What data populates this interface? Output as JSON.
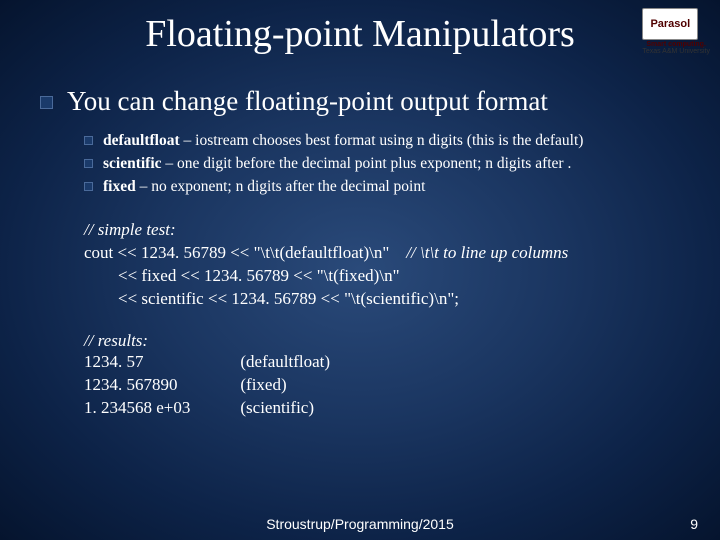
{
  "logo": {
    "name": "Parasol",
    "line1": "Smart computing.",
    "line2": "Texas A&M University"
  },
  "title": "Floating-point Manipulators",
  "main_bullet": "You can change floating-point output format",
  "sub_bullets": [
    {
      "bold": "defaultfloat",
      "rest": " – iostream chooses best format using n digits (this is the default)"
    },
    {
      "bold": "scientific",
      "rest": " – one digit before the decimal point plus exponent; n digits after ."
    },
    {
      "bold": "fixed",
      "rest": " – no exponent; n digits after the decimal point"
    }
  ],
  "code": {
    "comment1": "// simple test:",
    "l1a": "cout << 1234. 56789 << \"\\t\\t(defaultfloat)\\n\"",
    "l1c": "//  \\t\\t  to line up columns",
    "l2": "        << fixed << 1234. 56789 << \"\\t(fixed)\\n\"",
    "l3": "        << scientific << 1234. 56789 << \"\\t(scientific)\\n\";"
  },
  "results": {
    "comment": "// results:",
    "rows": [
      {
        "val": "1234. 57",
        "label": "(defaultfloat)"
      },
      {
        "val": "1234. 567890",
        "label": "(fixed)"
      },
      {
        "val": "1. 234568 e+03",
        "label": "(scientific)"
      }
    ]
  },
  "footer": "Stroustrup/Programming/2015",
  "page": "9"
}
